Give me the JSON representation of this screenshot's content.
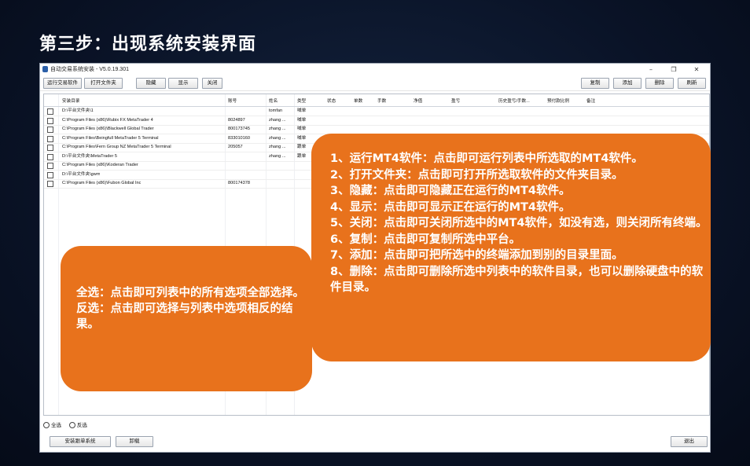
{
  "slide_title": "第三步：出现系统安装界面",
  "window": {
    "title": "自动交易系统安装 - V5.0.19.301",
    "controls": {
      "minimize": "–",
      "maximize": "❐",
      "close": "✕"
    }
  },
  "toolbar": {
    "left_buttons": [
      "运行交易软件",
      "打开文件夹",
      "隐藏",
      "显示",
      "关闭"
    ],
    "right_buttons": [
      "复制",
      "添加",
      "删除",
      "刷新"
    ]
  },
  "table": {
    "columns": [
      "安装目录",
      "账号",
      "姓名",
      "类型",
      "状态",
      "单数",
      "手数",
      "净值",
      "盈亏",
      "历史盈亏/手数...",
      "预付款比例",
      "备注"
    ],
    "rows": [
      {
        "dir": "D:\\平台文件夹\\1",
        "account": "",
        "name": "tomfan",
        "type": "喊单"
      },
      {
        "dir": "C:\\Program Files (x86)\\Rubix FX MetaTrader 4",
        "account": "8024897",
        "name": "zhang ...",
        "type": "喊单"
      },
      {
        "dir": "C:\\Program Files (x86)\\Blackwell Global Trader",
        "account": "800173745",
        "name": "zhang ...",
        "type": "喊单"
      },
      {
        "dir": "C:\\Program Files\\Beingfull MetaTrader 5 Terminal",
        "account": "833010160",
        "name": "zhang ...",
        "type": "喊单"
      },
      {
        "dir": "C:\\Program Files\\Fern Group NZ MetaTrader 5 Terminal",
        "account": "205057",
        "name": "zhang ...",
        "type": "跟单"
      },
      {
        "dir": "D:\\平台文件夹\\MetaTrader 5",
        "account": "",
        "name": "zhang ...",
        "type": "跟单"
      },
      {
        "dir": "C:\\Program Files (x86)\\Koderan Trader",
        "account": "",
        "name": "",
        "type": ""
      },
      {
        "dir": "D:\\平台文件夹\\gwm",
        "account": "",
        "name": "",
        "type": ""
      },
      {
        "dir": "C:\\Program Files (x86)\\Fubon Global Inc",
        "account": "800174378",
        "name": "",
        "type": ""
      }
    ]
  },
  "options": {
    "select_all": "全选",
    "invert": "反选"
  },
  "footer_buttons": {
    "install": "安装跟单系统",
    "uninstall": "卸载",
    "exit": "退出"
  },
  "callout_left": [
    "全选：点击即可列表中的所有选项全部选择。",
    "反选：点击即可选择与列表中选项相反的结果。"
  ],
  "callout_right": [
    "1、运行MT4软件：点击即可运行列表中所选取的MT4软件。",
    "2、打开文件夹：点击即可打开所选取软件的文件夹目录。",
    "3、隐藏：点击即可隐藏正在运行的MT4软件。",
    "4、显示：点击即可显示正在运行的MT4软件。",
    "5、关闭：点击即可关闭所选中的MT4软件，如没有选，则关闭所有终端。",
    "6、复制：点击即可复制所选中平台。",
    "7、添加：点击即可把所选中的终端添加到别的目录里面。",
    "8、删除：点击即可删除所选中列表中的软件目录，也可以删除硬盘中的软件目录。"
  ],
  "colors": {
    "callout": "#e8721c",
    "background": "#0a1327"
  }
}
